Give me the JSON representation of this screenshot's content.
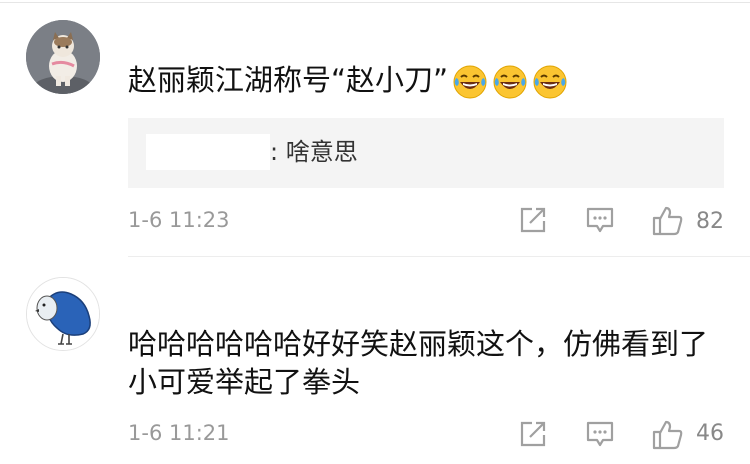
{
  "comments": [
    {
      "text": "赵丽颖江湖称号“赵小刀”",
      "emoji_icons": [
        "laughing-tears-icon",
        "laughing-tears-icon",
        "laughing-tears-icon"
      ],
      "reply": {
        "text": ": 啥意思"
      },
      "time": "1-6 11:23",
      "likes": "82"
    },
    {
      "text": "哈哈哈哈哈哈好好笑赵丽颖这个，仿佛看到了小可爱举起了拳头",
      "time": "1-6 11:21",
      "likes": "46"
    }
  ],
  "icons": {
    "share": "share-icon",
    "comment": "comment-icon",
    "like": "thumbs-up-icon"
  },
  "colors": {
    "meta_text": "#999999",
    "reply_background": "#f4f4f4",
    "emoji_yellow": "#fbc531"
  }
}
